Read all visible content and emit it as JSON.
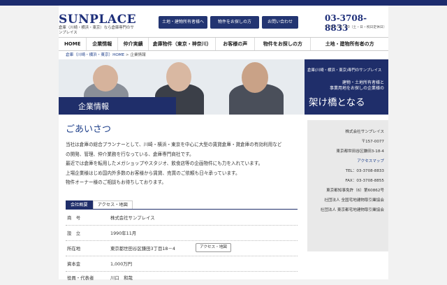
{
  "header": {
    "logo": "SUNPLACE",
    "logo_sub": "倉庫（川崎・横浜・東京）なら倉庫専門のサンプレイス",
    "buttons": [
      "土地・建物所有者様へ",
      "物件をお探しの方",
      "お問い合わせ"
    ],
    "phone": "03-3708-8833",
    "hours": "9：00〜18：00（土・日・祝日定休日）"
  },
  "nav": [
    "HOME",
    "企業情報",
    "仲介実績",
    "倉庫物件（東京・神奈川）",
    "お客様の声",
    "物件をお探しの方",
    "土地・建物所有者の方"
  ],
  "breadcrumb": {
    "link": "倉庫（川崎・横浜・東京）HOME",
    "sep": " > ",
    "current": "企業情報"
  },
  "hero": {
    "title": "企業情報",
    "tag": "倉庫(川崎・横浜・東京)専門のサンプレイス",
    "line1": "建物・土地所有者様と",
    "line2": "事業用地をお探しの企業様の",
    "headline": "架け橋となる"
  },
  "greeting": {
    "title": "ごあいさつ",
    "lines": [
      "当社は倉庫の総合プランナーとして、川崎・横浜・東京を中心に大型の賃貸倉庫・貸倉庫の有効利用など",
      "の開発、管理、仲介業務を行なっている、倉庫専門商社です。",
      "最近では倉庫を転用したメガショップやスタジオ、飲食店等の企画物件にも力を入れています。",
      "上場企業様はじめ国内外多数のお客様から賃貸、売買のご依頼も日々承っています。",
      "物件オーナー様のご相談もお待ちしております。"
    ]
  },
  "tabs": [
    "会社概要",
    "アクセス・地図"
  ],
  "company_table": [
    {
      "key": "商　号",
      "value": "株式会社サンプレイス"
    },
    {
      "key": "設　立",
      "value": "1990年11月"
    },
    {
      "key": "所在地",
      "value": "東京都世田谷区鎌田3丁目18－4",
      "button": "アクセス・地図"
    },
    {
      "key": "資本金",
      "value": "1,000万円"
    },
    {
      "key": "役員・代表者",
      "value": "川口　和哉"
    }
  ],
  "sidebar": {
    "company": "株式会社サンプレイス",
    "zip": "〒157-0077",
    "address": "東京都世田谷区鎌田3-18-4",
    "access_link": "アクセスマップ",
    "tel": "TEL：03-3708-8833",
    "fax": "FAX：03-3708-8855",
    "license": "東京都知事免許（6）第60862号",
    "assoc1": "社団法人 全国宅地建物取引業協会",
    "assoc2": "社団法人 東京都宅地建物取引業協会"
  }
}
